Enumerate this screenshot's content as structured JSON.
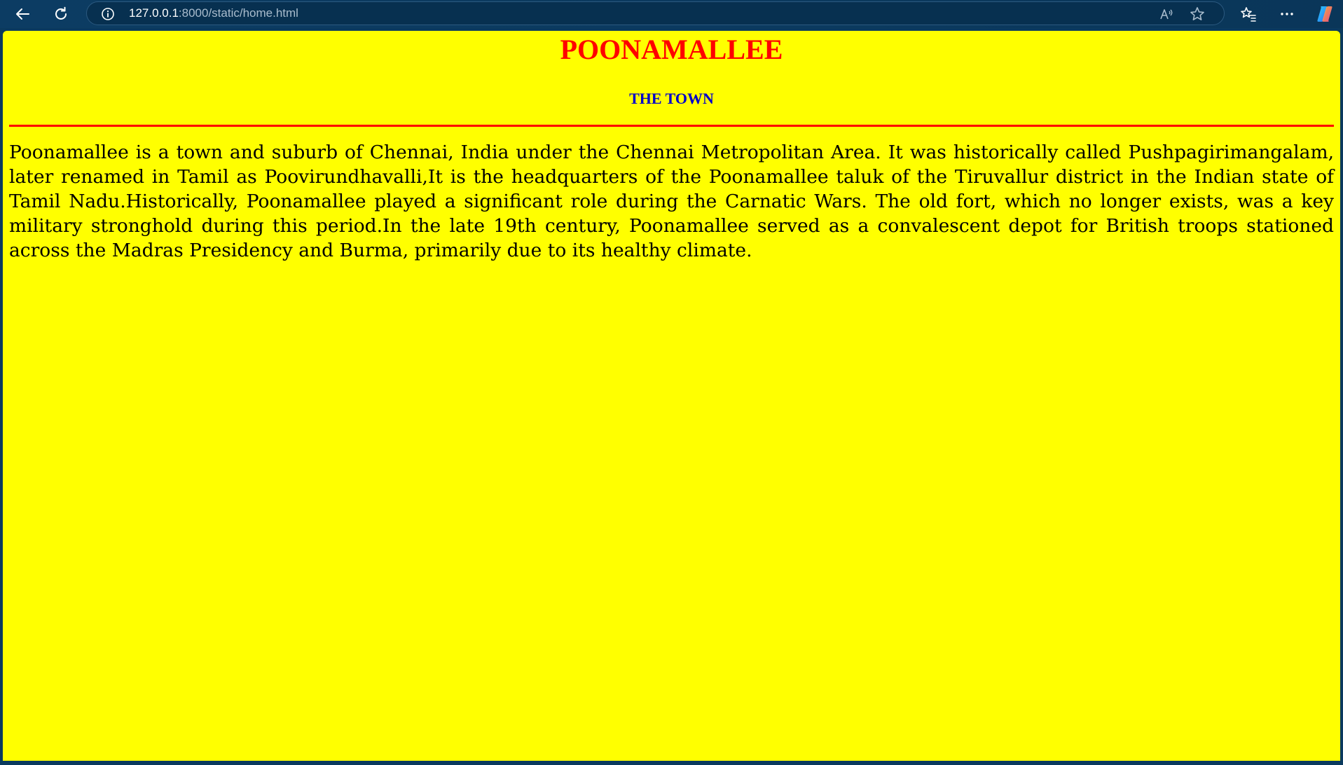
{
  "browser": {
    "url_host": "127.0.0.1",
    "url_path": ":8000/static/home.html",
    "icons": {
      "back": "back-arrow-icon",
      "refresh": "refresh-icon",
      "site_info": "info-icon",
      "read_aloud": "read-aloud-icon",
      "favorite": "star-icon",
      "favorites": "favorites-list-icon",
      "more": "more-menu-icon",
      "copilot": "copilot-icon"
    }
  },
  "page": {
    "title": "POONAMALLEE",
    "subtitle": "THE TOWN",
    "paragraph": "Poonamallee is a town and suburb of Chennai, India under the Chennai Metropolitan Area. It was historically called Pushpagirimangalam, later renamed in Tamil as Poovirundhavalli,It is the headquarters of the Poonamallee taluk of the Tiruvallur district in the Indian state of Tamil Nadu.Historically, Poonamallee played a significant role during the Carnatic Wars. The old fort, which no longer exists, was a key military stronghold during this period.In the late 19th century, Poonamallee served as a convalescent depot for British troops stationed across the Madras Presidency and Burma, primarily due to its healthy climate."
  },
  "colors": {
    "background": "#ffff00",
    "title": "#ff0000",
    "subtitle": "#0000cc",
    "divider": "#ff0000",
    "text": "#000000",
    "toolbar": "#0b3a5e"
  }
}
